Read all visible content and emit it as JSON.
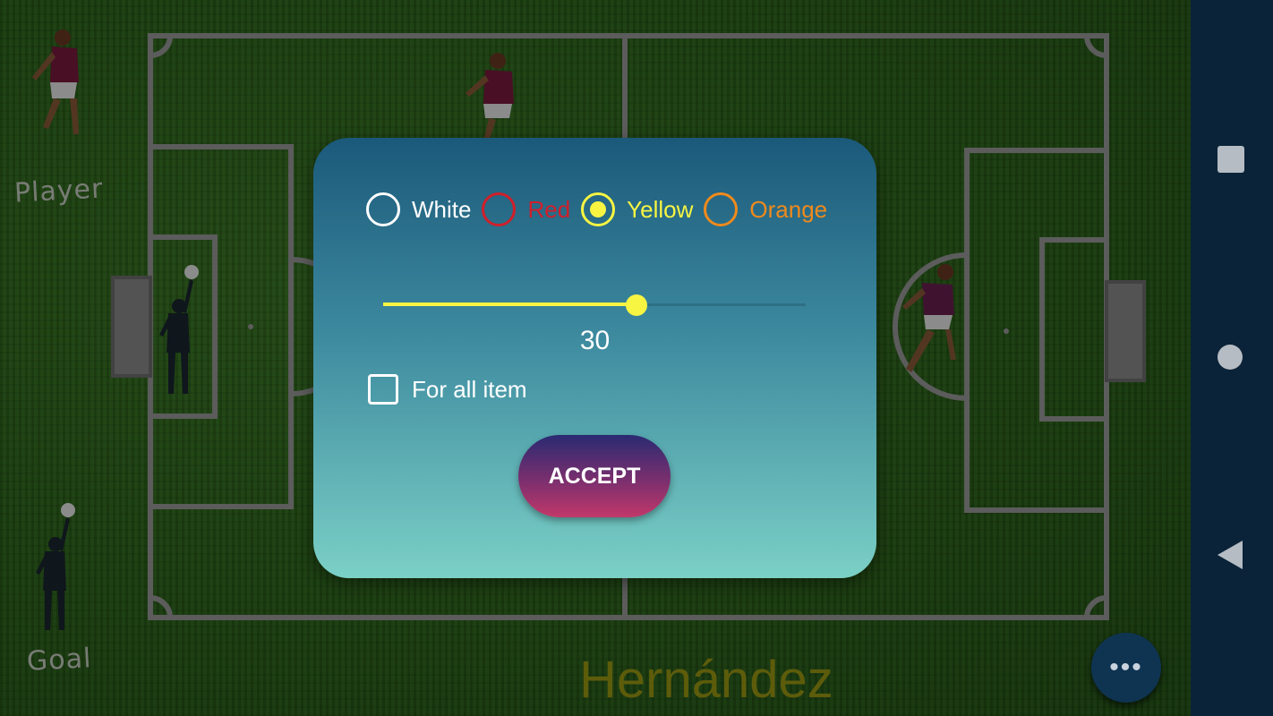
{
  "field": {
    "labels": {
      "player": "Player",
      "goal": "Goal"
    },
    "team_name": "Hernández"
  },
  "dialog": {
    "colors": [
      {
        "label": "White",
        "color": "#ffffff",
        "selected": false
      },
      {
        "label": "Red",
        "color": "#d01f2a",
        "selected": false
      },
      {
        "label": "Yellow",
        "color": "#f7f542",
        "selected": true
      },
      {
        "label": "Orange",
        "color": "#f08a1c",
        "selected": false
      }
    ],
    "slider": {
      "value": "30",
      "fraction": 0.6
    },
    "for_all_label": "For all item",
    "for_all_checked": false,
    "accept_label": "ACCEPT"
  },
  "fab": {
    "icon": "more-horiz-icon",
    "glyph": "•••"
  },
  "navbar": {
    "icons": [
      "recents-icon",
      "home-icon",
      "back-icon"
    ]
  }
}
